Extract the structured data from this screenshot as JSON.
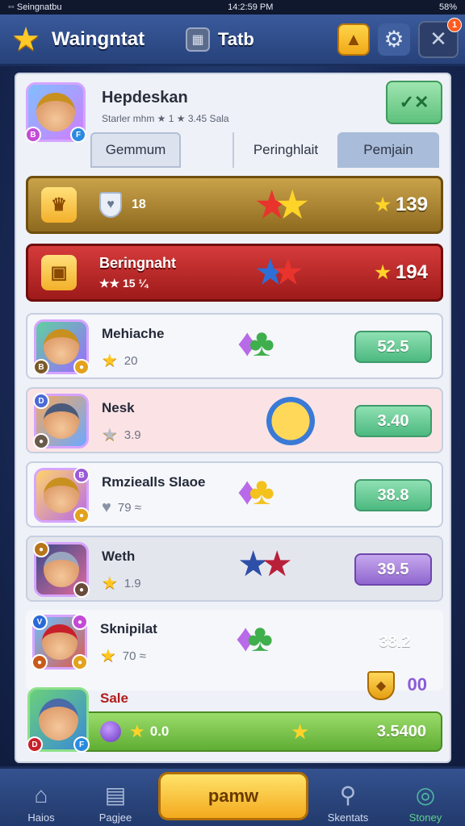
{
  "status": {
    "left": "◦◦ Seingnatbu",
    "time": "14:2:59 PM",
    "right": "58%"
  },
  "topbar": {
    "title": "Waingntat",
    "tab_title": "Tatb",
    "close_badge": "1"
  },
  "profile": {
    "name": "Hepdeskan",
    "sub": "Starler mhm ★ 1 ★ 3.45 Sala",
    "confirm": "✓✕"
  },
  "tabs": [
    "Gemmum",
    "Peringhlait",
    "Pemjain"
  ],
  "banners": [
    {
      "mid_value": "18",
      "score": "139",
      "title": "",
      "stat": ""
    },
    {
      "title": "Beringnaht",
      "stat": "★★ 15 ¼",
      "score": "194"
    }
  ],
  "players": [
    {
      "name": "Mehiache",
      "stat": "20",
      "value": "52.5"
    },
    {
      "name": "Nesk",
      "stat": "3.9",
      "value": "3.40"
    },
    {
      "name": "Rmziealls Slaoe",
      "stat": "79 ≈",
      "value": "38.8"
    },
    {
      "name": "Weth",
      "stat": "1.9",
      "value": "39.5"
    },
    {
      "name": "Sknipilat",
      "stat": "70 ≈",
      "value": "38.2"
    }
  ],
  "coin_value": "00",
  "bottom": {
    "sale": "Sale",
    "count": "0.0",
    "total": "3.5400"
  },
  "nav": {
    "home": "Haios",
    "pages": "Pagjee",
    "play": "pamw",
    "search": "Skentats",
    "store": "Stoney"
  }
}
